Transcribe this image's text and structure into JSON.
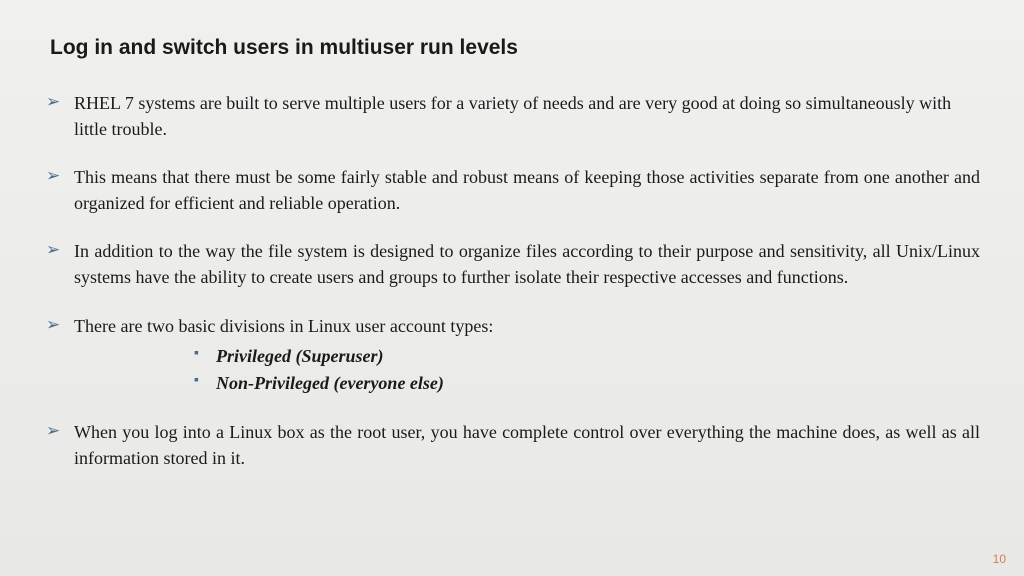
{
  "title": "Log in and switch users in multiuser run levels",
  "bullets": [
    {
      "text": "RHEL 7 systems are built to serve multiple users for a variety of needs and are very good at doing so simultaneously with little trouble.",
      "justify": false
    },
    {
      "text": "This means that there must be some fairly stable and robust means of keeping those activities separate from one another and organized for efficient and reliable operation.",
      "justify": true
    },
    {
      "text": "In addition to the way the file system is designed to organize files according to their purpose and sensitivity, all Unix/Linux systems have the ability to create users and groups to further isolate their respective accesses and functions.",
      "justify": true
    },
    {
      "text": "There are two basic divisions in Linux user account types:",
      "justify": false,
      "subitems": [
        "Privileged (Superuser)",
        "Non-Privileged (everyone else)"
      ]
    },
    {
      "text": "When you log into a Linux box as the root user, you have complete control over everything the machine does, as well as all information stored in it.",
      "justify": true
    }
  ],
  "pageNumber": "10"
}
